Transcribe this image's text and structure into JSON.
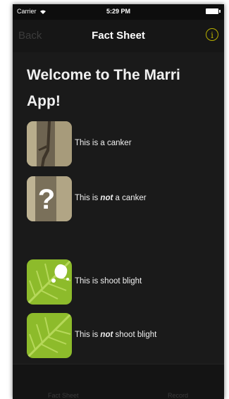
{
  "status_bar": {
    "carrier": "Carrier",
    "time": "5:29 PM"
  },
  "nav": {
    "back_label": "Back",
    "title": "Fact Sheet",
    "info_icon": "info-circle-icon"
  },
  "welcome": {
    "line1": "Welcome to The Marri",
    "line2": "App!"
  },
  "items": [
    {
      "before": "This is a canker",
      "emph": "",
      "after": "",
      "thumb": "bark-canker"
    },
    {
      "before": "This is ",
      "emph": "not",
      "after": " a canker",
      "thumb": "bark-question"
    },
    {
      "before": "This is shoot blight",
      "emph": "",
      "after": "",
      "thumb": "leaf-blight"
    },
    {
      "before": "This is ",
      "emph": "not",
      "after": " shoot blight",
      "thumb": "leaf-healthy"
    }
  ],
  "tabs": [
    {
      "label": "Fact Sheet"
    },
    {
      "label": "Record"
    }
  ],
  "colors": {
    "background": "#1b1b1b",
    "accent": "#b8b000",
    "leaf_green": "#8dbb2b",
    "bark_tan": "#a89a78"
  }
}
